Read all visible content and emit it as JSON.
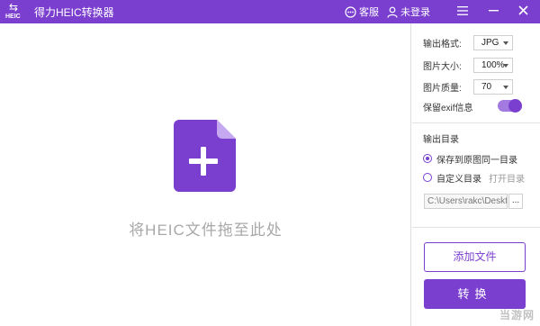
{
  "titlebar": {
    "logo_text": "HEIC",
    "app_title": "得力HEIC转换器",
    "service_label": "客服",
    "login_label": "未登录"
  },
  "main": {
    "drop_hint": "将HEIC文件拖至此处"
  },
  "panel": {
    "format_label": "输出格式:",
    "format_value": "JPG",
    "size_label": "图片大小:",
    "size_value": "100%",
    "quality_label": "图片质量:",
    "quality_value": "70",
    "exif_label": "保留exif信息",
    "exif_enabled": true,
    "output_dir_title": "输出目录",
    "option_same_dir": "保存到原图同一目录",
    "option_custom_dir": "自定义目录",
    "open_dir_label": "打开目录",
    "selected_option": "same",
    "path_value": "C:\\Users\\rakc\\Deskt",
    "browse_label": "...",
    "add_file_label": "添加文件",
    "convert_label": "转换"
  },
  "watermark": "当游网",
  "colors": {
    "accent": "#7b3fd0",
    "toggle_track": "#a37be0",
    "hint_text": "#a8a8a8"
  }
}
